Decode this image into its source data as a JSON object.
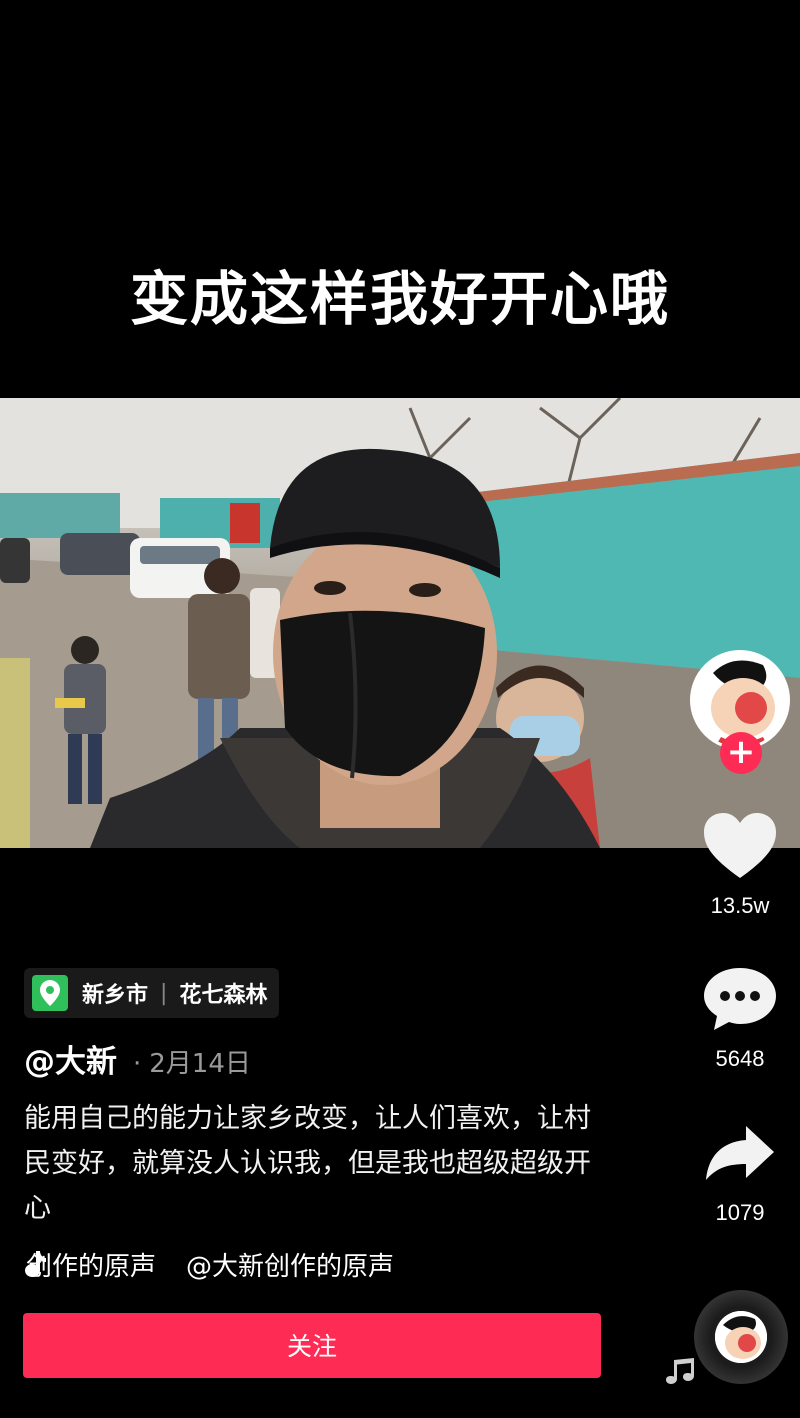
{
  "video": {
    "caption": "变成这样我好开心哦"
  },
  "creator": {
    "handle": "@大新",
    "date": "2月14日",
    "date_separator": "·",
    "follow_plus": "+"
  },
  "actions": {
    "likes": "13.5w",
    "comments": "5648",
    "shares": "1079"
  },
  "location": {
    "city": "新乡市",
    "separator": "|",
    "place": "花七森林"
  },
  "post": {
    "description": "能用自己的能力让家乡改变，让人们喜欢，让村民变好，就算没人认识我，但是我也超级超级开心"
  },
  "music": {
    "track_a": "创作的原声",
    "track_b": "@大新创作的原声"
  },
  "buttons": {
    "follow_label": "关注"
  },
  "icons": {
    "like": "heart-icon",
    "comment": "comment-bubble-icon",
    "share": "share-arrow-icon",
    "location": "location-pin-icon",
    "music": "music-note-icon"
  },
  "colors": {
    "accent": "#fe2c55",
    "location_pin": "#2fbf5b",
    "background": "#000000"
  }
}
